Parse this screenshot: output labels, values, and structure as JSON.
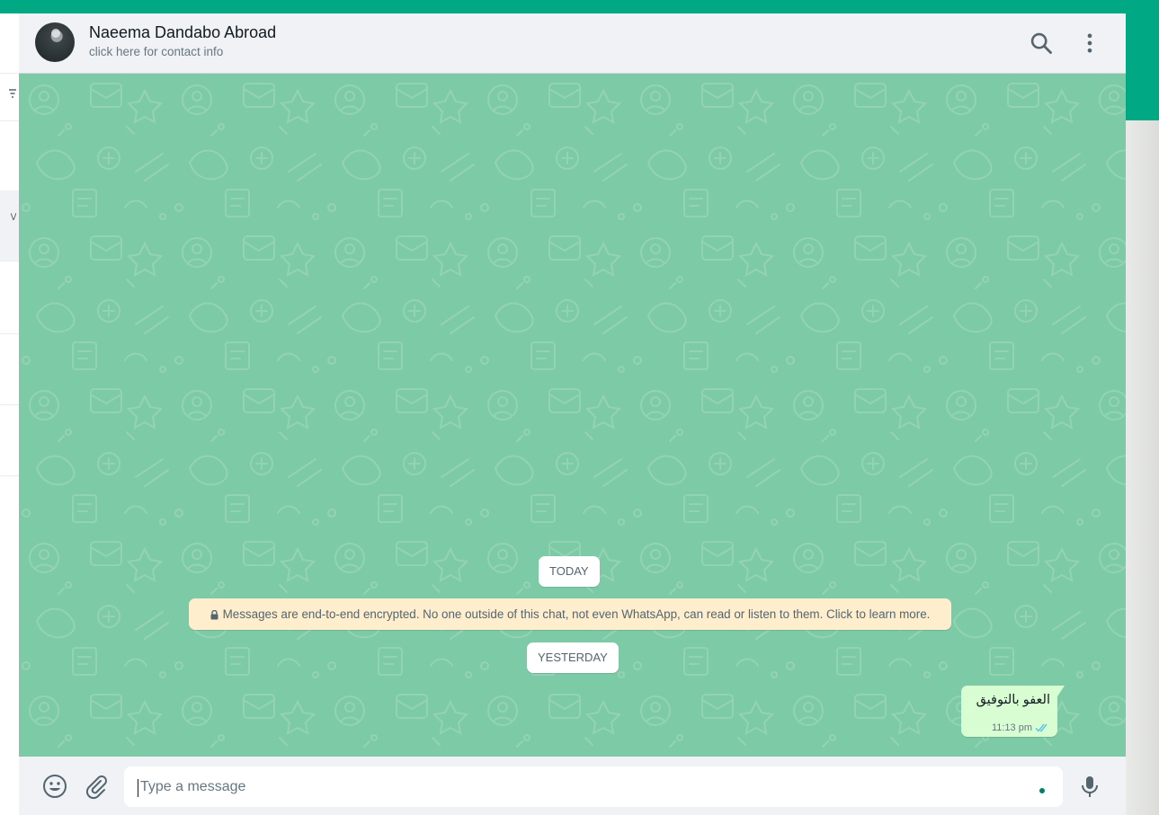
{
  "contact": {
    "name": "Naeema Dandabo Abroad",
    "subtitle": "click here for contact info"
  },
  "header": {
    "search_icon": "search-icon",
    "menu_icon": "menu-dots-icon"
  },
  "conversation": {
    "today_label": "TODAY",
    "encryption_notice": "Messages are end-to-end encrypted. No one outside of this chat, not even WhatsApp, can read or listen to them. Click to learn more.",
    "yesterday_label": "YESTERDAY",
    "messages": [
      {
        "text": "العفو بالتوفيق",
        "time": "11:13 pm",
        "status": "read"
      }
    ]
  },
  "composer": {
    "placeholder": "Type a message",
    "emoji_icon": "emoji-icon",
    "attach_icon": "paperclip-icon",
    "mic_icon": "microphone-icon"
  },
  "colors": {
    "brand": "#00a884",
    "chat_background": "#7dcaa6",
    "outgoing_bubble": "#d9fdd3",
    "notice_background": "#ffeecd",
    "read_ticks": "#53bdeb"
  }
}
